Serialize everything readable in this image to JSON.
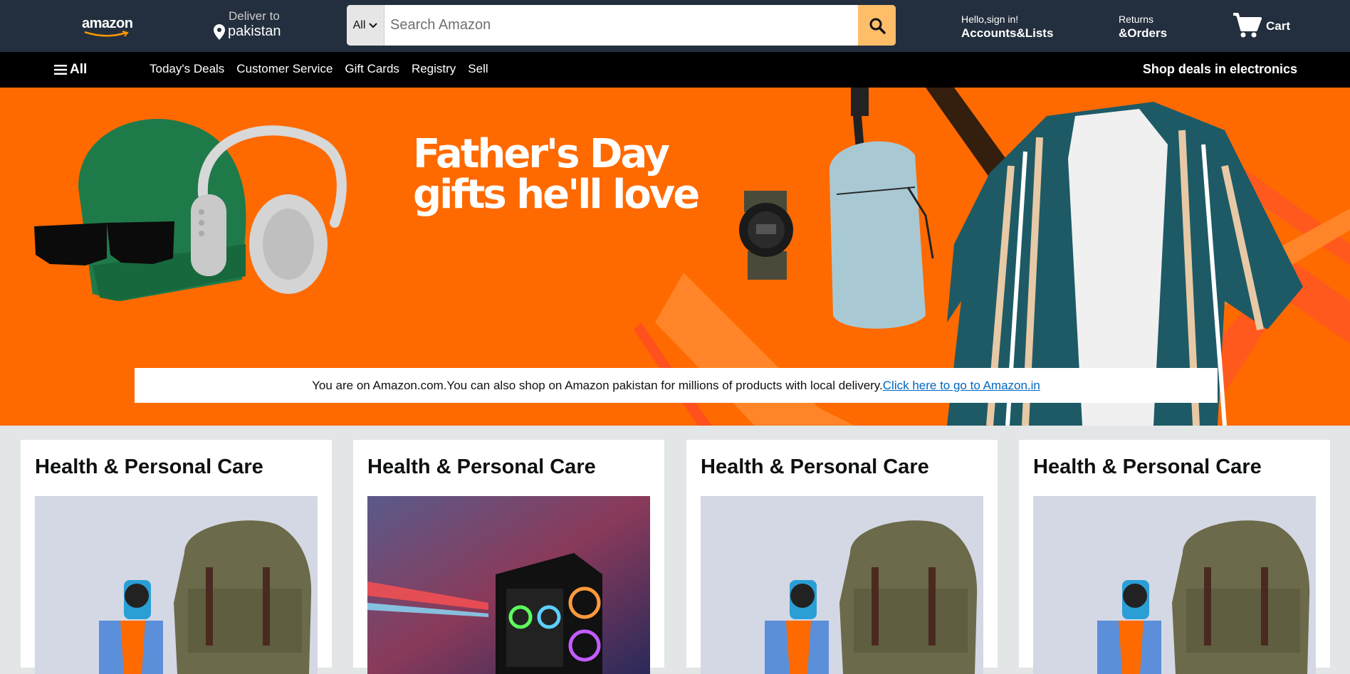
{
  "header": {
    "logo_text": "amazon",
    "deliver_label": "Deliver to",
    "deliver_location": "pakistan",
    "search_category": "All",
    "search_placeholder": "Search Amazon",
    "account_greeting": "Hello,sign in!",
    "account_label": "Accounts&Lists",
    "returns_label": "Returns",
    "orders_label": "&Orders",
    "cart_label": "Cart"
  },
  "nav": {
    "all_label": "All",
    "links": [
      "Today's Deals",
      "Customer Service",
      "Gift Cards",
      "Registry",
      "Sell"
    ],
    "promo": "Shop deals in electronics"
  },
  "hero": {
    "title_line1": "Father's Day",
    "title_line2": "gifts he'll love",
    "notice_text": "You are on Amazon.com.You can also shop on Amazon pakistan for millions of products with local delivery.",
    "notice_link": "Click here to go to Amazon.in"
  },
  "cards": [
    {
      "title": "Health & Personal Care",
      "image": "backpack-watch"
    },
    {
      "title": "Health & Personal Care",
      "image": "gaming-pc"
    },
    {
      "title": "Health & Personal Care",
      "image": "backpack-watch"
    },
    {
      "title": "Health & Personal Care",
      "image": "backpack-watch"
    }
  ],
  "colors": {
    "header_bg": "#232f3e",
    "nav_bg": "#000000",
    "hero_bg": "#ff6a00",
    "search_button": "#febd69",
    "link": "#0066c0",
    "page_bg": "#e3e6e6"
  }
}
